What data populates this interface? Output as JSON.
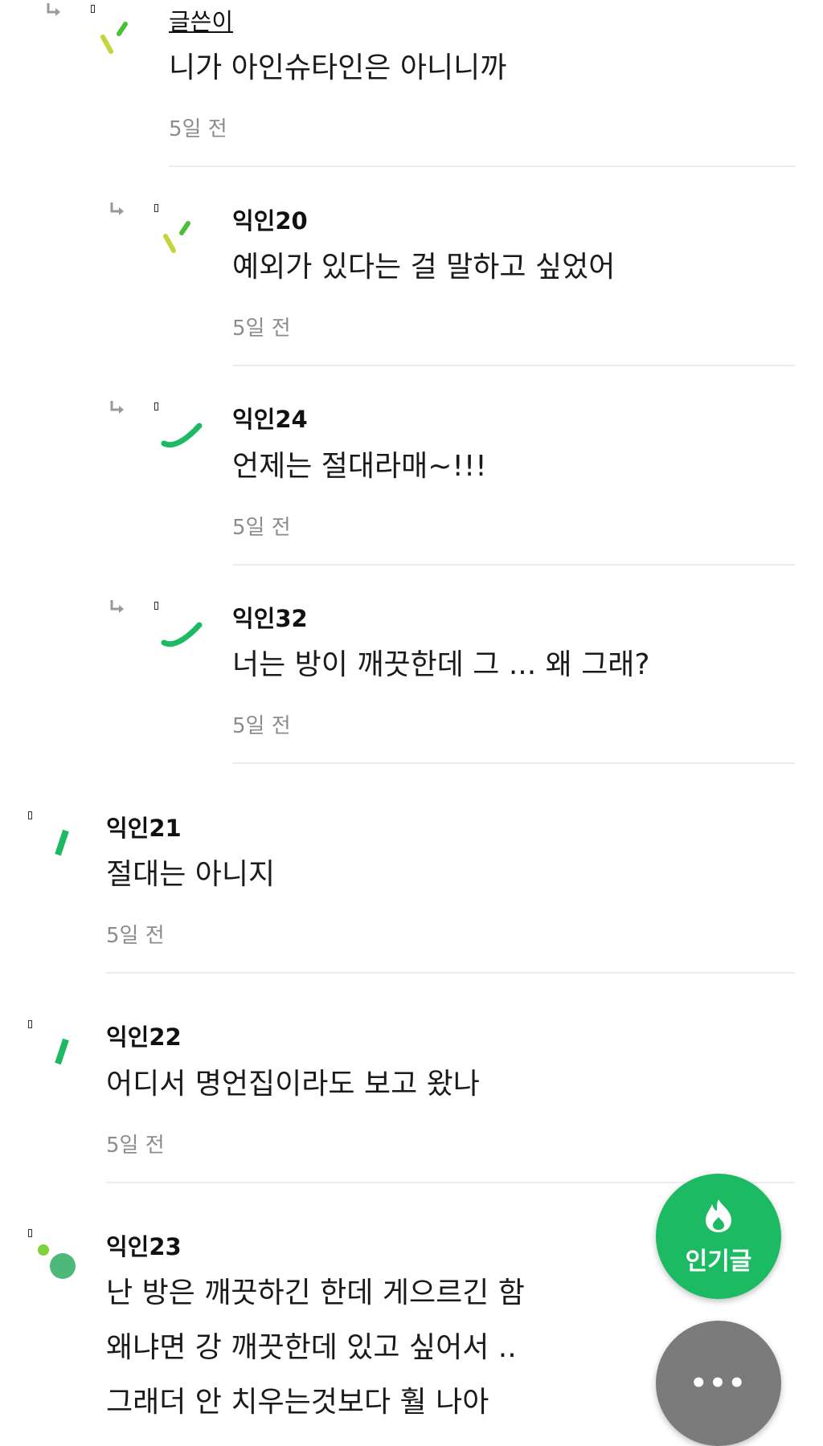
{
  "colors": {
    "accent": "#1dba64",
    "divider": "#ececec",
    "time_text": "#8c8c8c",
    "more_button": "#7b7b7b"
  },
  "comments": [
    {
      "author": "글쓴이",
      "content": "니가 아인슈타인은 아니니까",
      "time": "5일 전",
      "is_reply": true,
      "avatar_icon": "slash-avatar-icon"
    },
    {
      "author": "익인20",
      "content": "예외가 있다는 걸 말하고 싶었어",
      "time": "5일 전",
      "is_reply": true,
      "avatar_icon": "slash-avatar-icon"
    },
    {
      "author": "익인24",
      "content": "언제는 절대라매~!!!",
      "time": "5일 전",
      "is_reply": true,
      "avatar_icon": "smile-avatar-icon"
    },
    {
      "author": "익인32",
      "content": "너는 방이 깨끗한데 그 ... 왜 그래?",
      "time": "5일 전",
      "is_reply": true,
      "avatar_icon": "smile-avatar-icon"
    },
    {
      "author": "익인21",
      "content": "절대는 아니지",
      "time": "5일 전",
      "is_reply": false,
      "avatar_icon": "dash-avatar-icon"
    },
    {
      "author": "익인22",
      "content": "어디서 명언집이라도 보고 왔나",
      "time": "5일 전",
      "is_reply": false,
      "avatar_icon": "dash-avatar-icon"
    },
    {
      "author": "익인23",
      "content_lines": [
        "난 방은 깨끗하긴 한데 게으르긴 함",
        "왜냐면 강 깨끗한데 있고 싶어서 ..",
        "그래더 안 치우는것보다 훨 나아"
      ],
      "is_reply": false,
      "avatar_icon": "dots-avatar-icon"
    }
  ],
  "fab": {
    "popular_label": "인기글",
    "popular_icon": "fire-icon",
    "more_label": "•••",
    "more_icon": "more-dots-icon"
  }
}
